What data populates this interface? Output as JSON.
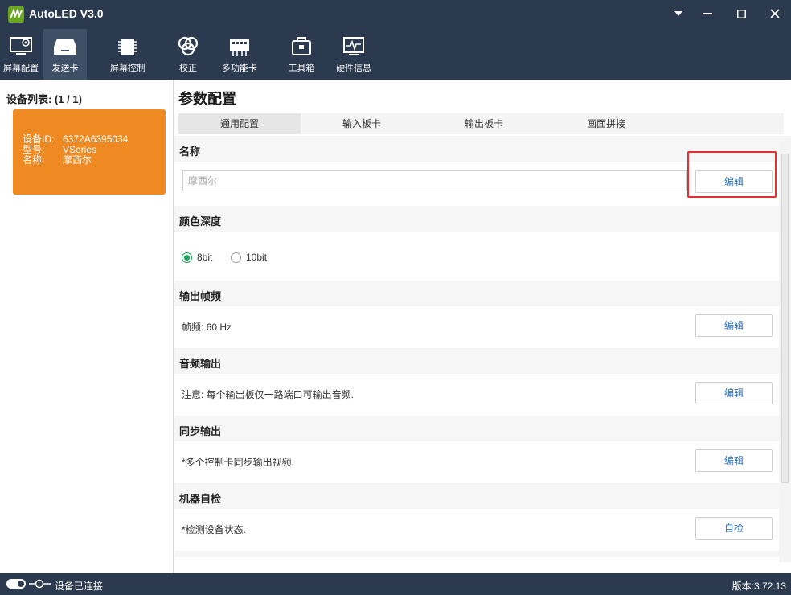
{
  "window": {
    "title": "AutoLED V3.0"
  },
  "toolbar": {
    "items": [
      {
        "label": "屏幕配置",
        "icon": "monitor-settings-icon"
      },
      {
        "label": "发送卡",
        "icon": "sender-card-icon"
      },
      {
        "label": "屏幕控制",
        "icon": "chip-icon"
      },
      {
        "label": "校正",
        "icon": "color-wheel-icon"
      },
      {
        "label": "多功能卡",
        "icon": "multifunction-card-icon"
      },
      {
        "label": "工具箱",
        "icon": "toolbox-icon"
      },
      {
        "label": "硬件信息",
        "icon": "hardware-monitor-icon"
      }
    ],
    "active_index": 1
  },
  "sidebar": {
    "header": "设备列表: (1 / 1)",
    "device": {
      "id_label": "设备ID:",
      "id_value": "6372A6395034",
      "type_label": "型号:",
      "type_value": "VSeries",
      "name_label": "名称:",
      "name_value": "摩西尔"
    }
  },
  "main": {
    "title": "参数配置",
    "tabs": [
      "通用配置",
      "输入板卡",
      "输出板卡",
      "画面拼接"
    ],
    "active_tab": 0,
    "sections": {
      "name": {
        "title": "名称",
        "placeholder": "摩西尔",
        "button": "编辑"
      },
      "color_depth": {
        "title": "颜色深度",
        "options": [
          "8bit",
          "10bit"
        ],
        "selected": "8bit"
      },
      "frame_rate": {
        "title": "输出帧频",
        "text": "帧频: 60 Hz",
        "button": "编辑"
      },
      "audio": {
        "title": "音频输出",
        "text": "注意: 每个输出板仅一路端口可输出音频.",
        "button": "编辑"
      },
      "sync": {
        "title": "同步输出",
        "text": "*多个控制卡同步输出视频.",
        "button": "编辑"
      },
      "self_check": {
        "title": "机器自检",
        "text": "*检测设备状态.",
        "button": "自检"
      }
    }
  },
  "statusbar": {
    "status": "设备已连接",
    "version": "版本:3.72.13"
  },
  "colors": {
    "chrome": "#2b3a4f",
    "device_card": "#ef8a22",
    "highlight": "#e03030",
    "radio_on": "#1aa35a",
    "button_text": "#2e6fb3"
  }
}
